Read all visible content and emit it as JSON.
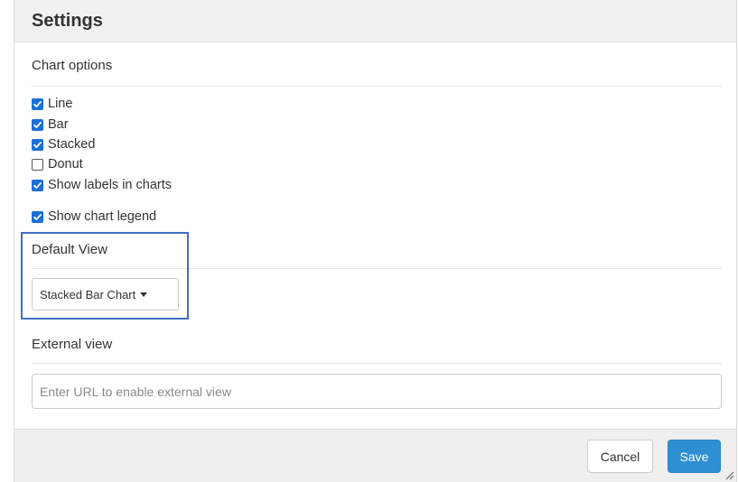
{
  "dialog": {
    "title": "Settings"
  },
  "chart_options": {
    "heading": "Chart options",
    "items": [
      {
        "label": "Line",
        "checked": true
      },
      {
        "label": "Bar",
        "checked": true
      },
      {
        "label": "Stacked",
        "checked": true
      },
      {
        "label": "Donut",
        "checked": false
      },
      {
        "label": "Show labels in charts",
        "checked": true
      }
    ],
    "legend": {
      "label": "Show chart legend",
      "checked": true
    }
  },
  "default_view": {
    "heading": "Default View",
    "selected": "Stacked Bar Chart"
  },
  "external_view": {
    "heading": "External view",
    "placeholder": "Enter URL to enable external view",
    "value": ""
  },
  "footer": {
    "cancel_label": "Cancel",
    "save_label": "Save"
  },
  "icons": {
    "checkbox_check": "check-icon",
    "dropdown": "caret-down-icon",
    "resize": "resize-handle-icon"
  },
  "colors": {
    "checkbox_accent": "#1b6fd6",
    "highlight_border": "#3f6fc5",
    "save_button": "#2f8fd3",
    "header_bg": "#f1f1f1",
    "footer_bg": "#efefef"
  }
}
